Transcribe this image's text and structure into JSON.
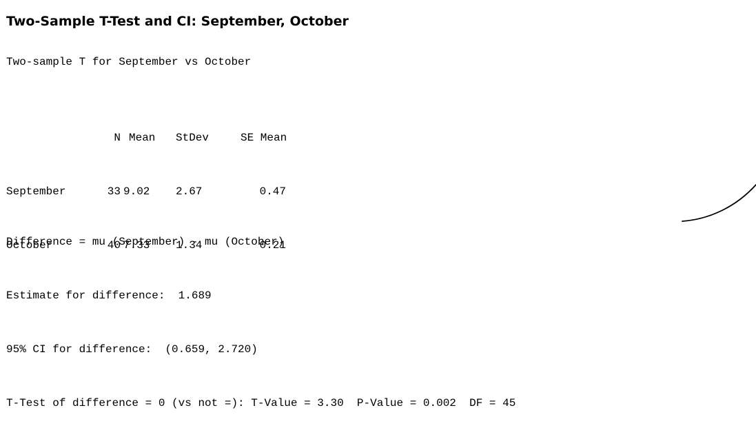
{
  "title": "Two-Sample T-Test and CI: September, October",
  "subtitle": "Two-sample T for September vs October",
  "table": {
    "headers": {
      "name": "",
      "n": "N",
      "mean": "Mean",
      "stdev": "StDev",
      "se_mean": "SE Mean"
    },
    "rows": [
      {
        "name": "September",
        "n": "33",
        "mean": "9.02",
        "stdev": "2.67",
        "se_mean": "0.47"
      },
      {
        "name": "October",
        "n": "40",
        "mean": "7.33",
        "stdev": "1.34",
        "se_mean": "0.21"
      }
    ]
  },
  "results": {
    "difference": "Difference = mu (September) - mu (October)",
    "estimate": "Estimate for difference:  1.689",
    "ci": "95% CI for difference:  (0.659, 2.720)",
    "ttest": "T-Test of difference = 0 (vs not =): T-Value = 3.30  P-Value = 0.002  DF = 45"
  },
  "annotation": {
    "kind": "hand-drawn-curve",
    "color": "#000000"
  }
}
